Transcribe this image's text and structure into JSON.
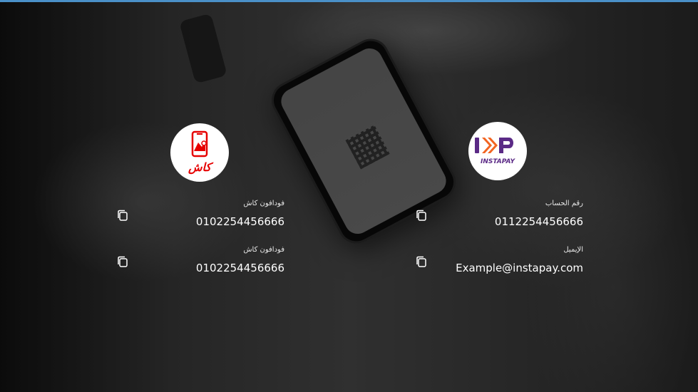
{
  "vodafone_cash": {
    "logo_icon": "vodafone-cash-logo",
    "logo_text": "كاش",
    "accent_color": "#e60000",
    "fields": [
      {
        "label": "فودافون كاش",
        "value": "0102254456666"
      },
      {
        "label": "فودافون كاش",
        "value": "0102254456666"
      }
    ]
  },
  "instapay": {
    "logo_icon": "instapay-logo",
    "logo_text": "INSTAPAY",
    "accent_color": "#5b2a86",
    "secondary_color": "#f26522",
    "fields": [
      {
        "label": "رقم الحساب",
        "value": "0112254456666"
      },
      {
        "label": "الإيميل",
        "value": "Example@instapay.com"
      }
    ]
  },
  "icons": {
    "copy": "copy-icon"
  }
}
